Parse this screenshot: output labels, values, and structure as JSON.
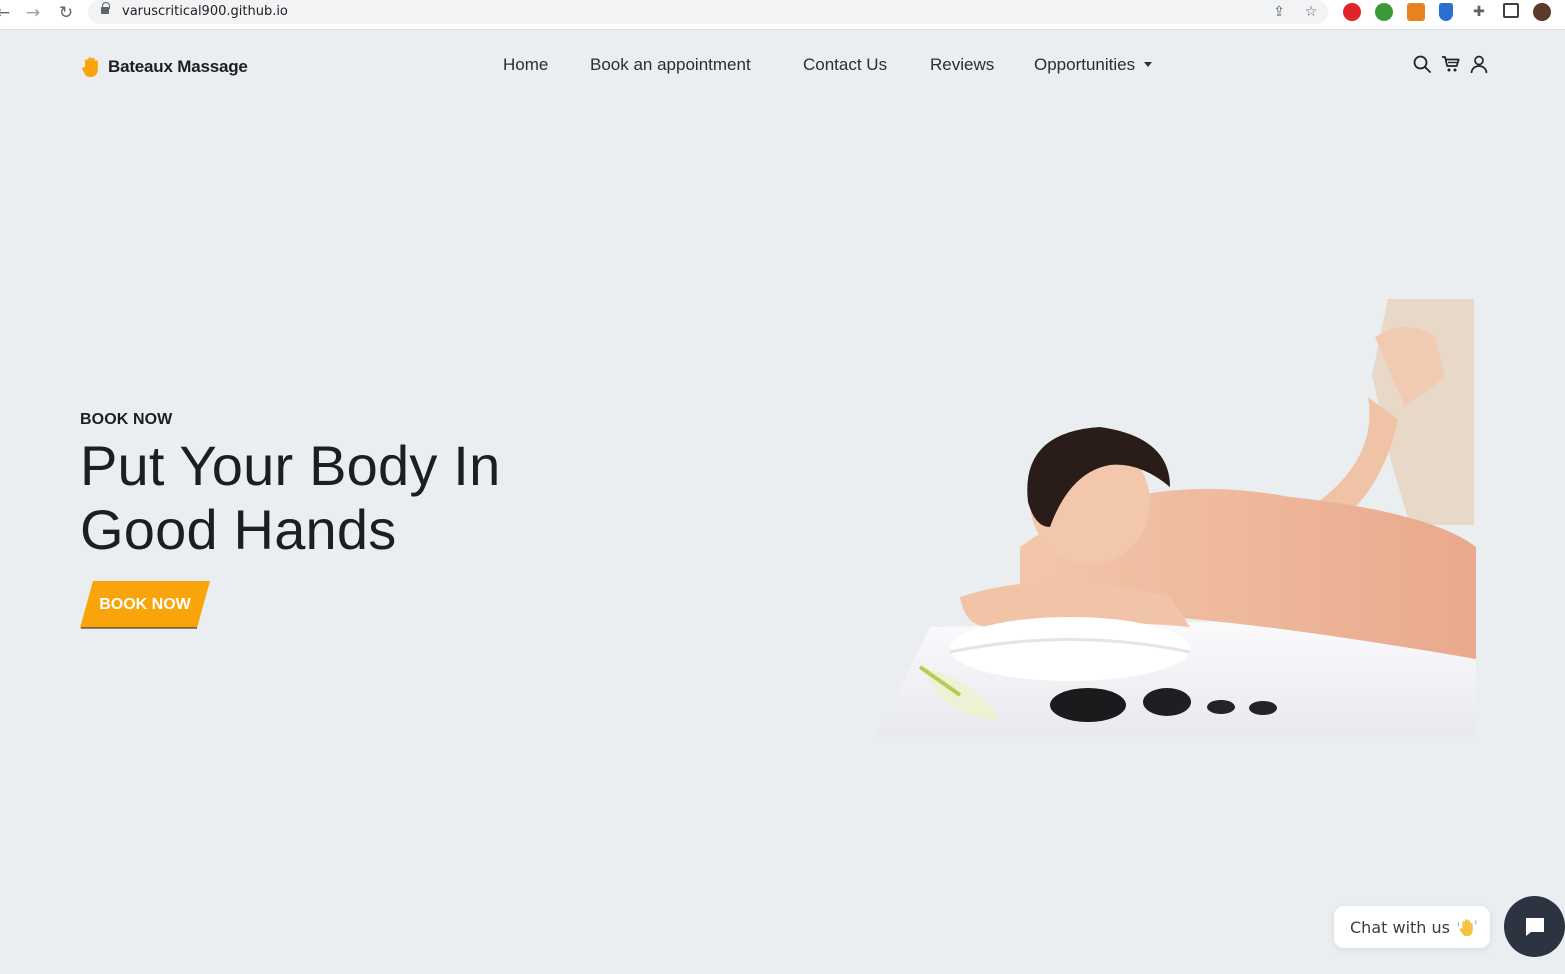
{
  "browser": {
    "url": "varuscritical900.github.io",
    "back_icon": "arrow-left-icon",
    "forward_icon": "arrow-right-icon",
    "reload_icon": "reload-icon"
  },
  "header": {
    "brand": "Bateaux Massage",
    "nav": [
      {
        "label": "Home"
      },
      {
        "label": "Book an appointment"
      },
      {
        "label": "Contact Us"
      },
      {
        "label": "Reviews"
      },
      {
        "label": "Opportunities"
      }
    ],
    "icons": [
      "search-icon",
      "cart-icon",
      "user-icon"
    ]
  },
  "hero": {
    "eyebrow": "BOOK NOW",
    "headline_line1": "Put Your Body In",
    "headline_line2": "Good Hands",
    "cta": "BOOK NOW"
  },
  "chat": {
    "label": "Chat with us"
  },
  "colors": {
    "accent": "#f9a40b",
    "background": "#ebeef1",
    "chat_button": "#2b3440"
  }
}
